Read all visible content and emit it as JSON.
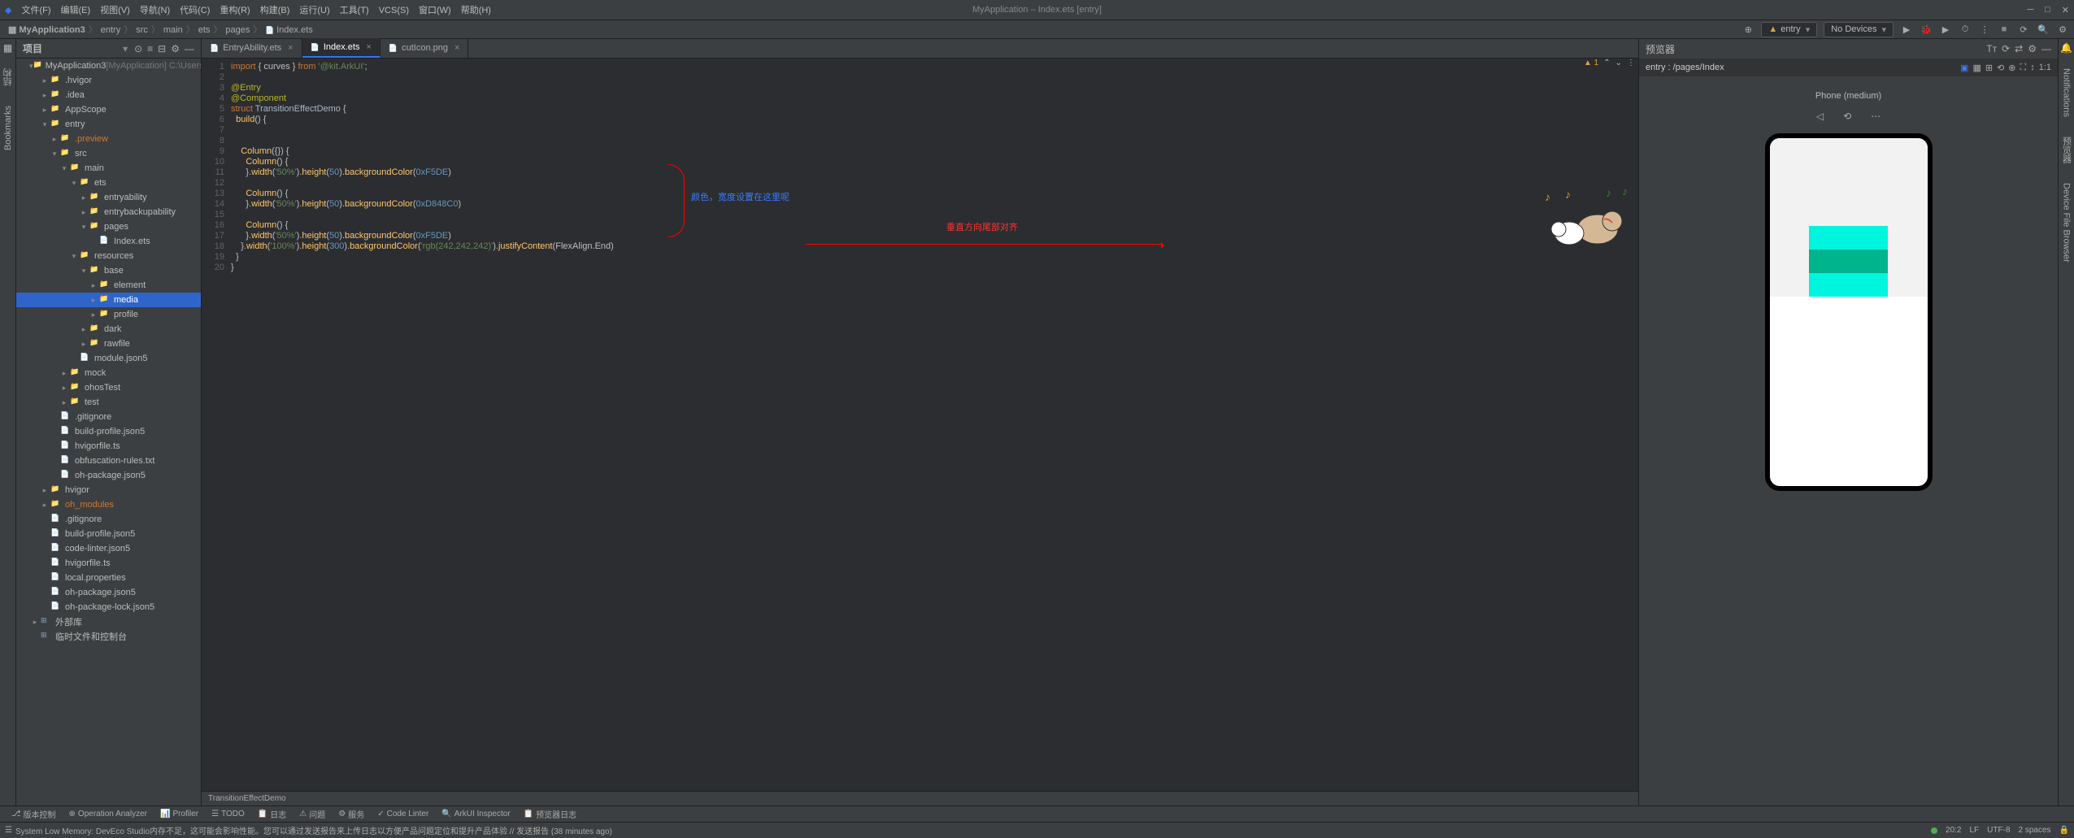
{
  "window": {
    "title": "MyApplication – Index.ets [entry]"
  },
  "menu": [
    "文件(F)",
    "编辑(E)",
    "视图(V)",
    "导航(N)",
    "代码(C)",
    "重构(R)",
    "构建(B)",
    "运行(U)",
    "工具(T)",
    "VCS(S)",
    "窗口(W)",
    "帮助(H)"
  ],
  "breadcrumbs": [
    "MyApplication3",
    "entry",
    "src",
    "main",
    "ets",
    "pages",
    "Index.ets"
  ],
  "run_config": {
    "build_target": "entry",
    "device": "No Devices"
  },
  "project_panel": {
    "title": "项目",
    "root": "MyApplication3",
    "root_extra": "[MyApplication]  C:\\Users\\MSN\\DevEcoS",
    "tree": [
      {
        "d": 1,
        "arrow": "v",
        "icon": "folder",
        "label": "MyApplication3",
        "extra": "[MyApplication]  C:\\Users\\MSN\\DevEcoS",
        "sel": false
      },
      {
        "d": 2,
        "arrow": ">",
        "icon": "folder",
        "label": ".hvigor"
      },
      {
        "d": 2,
        "arrow": ">",
        "icon": "folder",
        "label": ".idea"
      },
      {
        "d": 2,
        "arrow": ">",
        "icon": "folder",
        "label": "AppScope"
      },
      {
        "d": 2,
        "arrow": "v",
        "icon": "folder",
        "label": "entry"
      },
      {
        "d": 3,
        "arrow": ">",
        "icon": "folder",
        "label": ".preview",
        "highlight": "orange"
      },
      {
        "d": 3,
        "arrow": "v",
        "icon": "folder",
        "label": "src"
      },
      {
        "d": 4,
        "arrow": "v",
        "icon": "folder",
        "label": "main"
      },
      {
        "d": 5,
        "arrow": "v",
        "icon": "folder",
        "label": "ets"
      },
      {
        "d": 6,
        "arrow": ">",
        "icon": "folder",
        "label": "entryability"
      },
      {
        "d": 6,
        "arrow": ">",
        "icon": "folder",
        "label": "entrybackupability"
      },
      {
        "d": 6,
        "arrow": "v",
        "icon": "folder",
        "label": "pages"
      },
      {
        "d": 7,
        "arrow": "",
        "icon": "file",
        "label": "Index.ets"
      },
      {
        "d": 5,
        "arrow": "v",
        "icon": "folder",
        "label": "resources"
      },
      {
        "d": 6,
        "arrow": "v",
        "icon": "folder",
        "label": "base"
      },
      {
        "d": 7,
        "arrow": ">",
        "icon": "folder",
        "label": "element"
      },
      {
        "d": 7,
        "arrow": ">",
        "icon": "folder",
        "label": "media",
        "sel": true
      },
      {
        "d": 7,
        "arrow": ">",
        "icon": "folder",
        "label": "profile"
      },
      {
        "d": 6,
        "arrow": ">",
        "icon": "folder",
        "label": "dark"
      },
      {
        "d": 6,
        "arrow": ">",
        "icon": "folder",
        "label": "rawfile"
      },
      {
        "d": 5,
        "arrow": "",
        "icon": "file",
        "label": "module.json5"
      },
      {
        "d": 4,
        "arrow": ">",
        "icon": "folder",
        "label": "mock"
      },
      {
        "d": 4,
        "arrow": ">",
        "icon": "folder",
        "label": "ohosTest"
      },
      {
        "d": 4,
        "arrow": ">",
        "icon": "folder",
        "label": "test"
      },
      {
        "d": 3,
        "arrow": "",
        "icon": "file",
        "label": ".gitignore"
      },
      {
        "d": 3,
        "arrow": "",
        "icon": "file",
        "label": "build-profile.json5"
      },
      {
        "d": 3,
        "arrow": "",
        "icon": "file",
        "label": "hvigorfile.ts"
      },
      {
        "d": 3,
        "arrow": "",
        "icon": "file",
        "label": "obfuscation-rules.txt"
      },
      {
        "d": 3,
        "arrow": "",
        "icon": "file",
        "label": "oh-package.json5"
      },
      {
        "d": 2,
        "arrow": ">",
        "icon": "folder",
        "label": "hvigor"
      },
      {
        "d": 2,
        "arrow": ">",
        "icon": "folder",
        "label": "oh_modules",
        "highlight": "orange"
      },
      {
        "d": 2,
        "arrow": "",
        "icon": "file",
        "label": ".gitignore"
      },
      {
        "d": 2,
        "arrow": "",
        "icon": "file",
        "label": "build-profile.json5"
      },
      {
        "d": 2,
        "arrow": "",
        "icon": "file",
        "label": "code-linter.json5"
      },
      {
        "d": 2,
        "arrow": "",
        "icon": "file",
        "label": "hvigorfile.ts"
      },
      {
        "d": 2,
        "arrow": "",
        "icon": "file",
        "label": "local.properties"
      },
      {
        "d": 2,
        "arrow": "",
        "icon": "file",
        "label": "oh-package.json5"
      },
      {
        "d": 2,
        "arrow": "",
        "icon": "file",
        "label": "oh-package-lock.json5"
      },
      {
        "d": 1,
        "arrow": ">",
        "icon": "lib",
        "label": "外部库"
      },
      {
        "d": 1,
        "arrow": "",
        "icon": "lib",
        "label": "临时文件和控制台"
      }
    ]
  },
  "tabs": [
    {
      "label": "EntryAbility.ets",
      "active": false
    },
    {
      "label": "Index.ets",
      "active": true
    },
    {
      "label": "cutIcon.png",
      "active": false
    }
  ],
  "editor": {
    "warning_count": "1",
    "lines": [
      {
        "n": 1,
        "html": "<span class='c-kw'>import</span> { curves } <span class='c-kw'>from</span> <span class='c-str'>'@kit.ArkUI'</span>;"
      },
      {
        "n": 2,
        "html": ""
      },
      {
        "n": 3,
        "html": "<span class='c-dec'>@Entry</span>"
      },
      {
        "n": 4,
        "html": "<span class='c-dec'>@Component</span>"
      },
      {
        "n": 5,
        "html": "<span class='c-kw'>struct</span> <span class='c-type'>TransitionEffectDemo</span> {"
      },
      {
        "n": 6,
        "html": "  <span class='c-fn'>build</span>() {"
      },
      {
        "n": 7,
        "html": ""
      },
      {
        "n": 8,
        "html": ""
      },
      {
        "n": 9,
        "html": "    <span class='c-fn'>Column</span>({}) {"
      },
      {
        "n": 10,
        "html": "      <span class='c-fn'>Column</span>() {"
      },
      {
        "n": 11,
        "html": "      }.<span class='c-fn'>width</span>(<span class='c-str'>'50%'</span>).<span class='c-fn'>height</span>(<span class='c-num'>50</span>).<span class='c-fn'>backgroundColor</span>(<span class='c-num'>0xF5DE</span>)"
      },
      {
        "n": 12,
        "html": ""
      },
      {
        "n": 13,
        "html": "      <span class='c-fn'>Column</span>() {"
      },
      {
        "n": 14,
        "html": "      }.<span class='c-fn'>width</span>(<span class='c-str'>'50%'</span>).<span class='c-fn'>height</span>(<span class='c-num'>50</span>).<span class='c-fn'>backgroundColor</span>(<span class='c-num'>0xD848C0</span>)"
      },
      {
        "n": 15,
        "html": ""
      },
      {
        "n": 16,
        "html": "      <span class='c-fn'>Column</span>() {"
      },
      {
        "n": 17,
        "html": "      }.<span class='c-fn'>width</span>(<span class='c-str'>'50%'</span>).<span class='c-fn'>height</span>(<span class='c-num'>50</span>).<span class='c-fn'>backgroundColor</span>(<span class='c-num'>0xF5DE</span>)"
      },
      {
        "n": 18,
        "html": "    }.<span class='c-fn'>width</span>(<span class='c-str'>'100%'</span>).<span class='c-fn'>height</span>(<span class='c-num'>300</span>).<span class='c-fn'>backgroundColor</span>(<span class='c-str'>'rgb(242,242,242)'</span>).<span class='c-fn'>justifyContent</span>(FlexAlign.End)"
      },
      {
        "n": 19,
        "html": "  }"
      },
      {
        "n": 20,
        "html": "}"
      }
    ],
    "breadcrumb": "TransitionEffectDemo",
    "annotation1": "颜色，宽度设置在这里呢",
    "annotation2": "垂直方向尾部对齐"
  },
  "previewer": {
    "title": "预览器",
    "entry": "entry : /pages/Index",
    "device": "Phone (medium)"
  },
  "left_sidebar": {
    "structure": "结构",
    "bookmarks": "Bookmarks"
  },
  "right_sidebar": {
    "notifications": "Notifications",
    "previewer": "预览器",
    "device_browser": "Device File Browser"
  },
  "bottom_tools": [
    "版本控制",
    "Operation Analyzer",
    "Profiler",
    "TODO",
    "日志",
    "问题",
    "服务",
    "Code Linter",
    "ArkUI Inspector",
    "预览器日志"
  ],
  "status": {
    "msg": "System Low Memory: DevEco Studio内存不足，这可能会影响性能。您可以通过发送报告来上传日志以方便产品问题定位和提升产品体验 // 发送报告 (38 minutes ago)",
    "cursor": "20:2",
    "line_sep": "LF",
    "encoding": "UTF-8",
    "indent": "2 spaces"
  }
}
